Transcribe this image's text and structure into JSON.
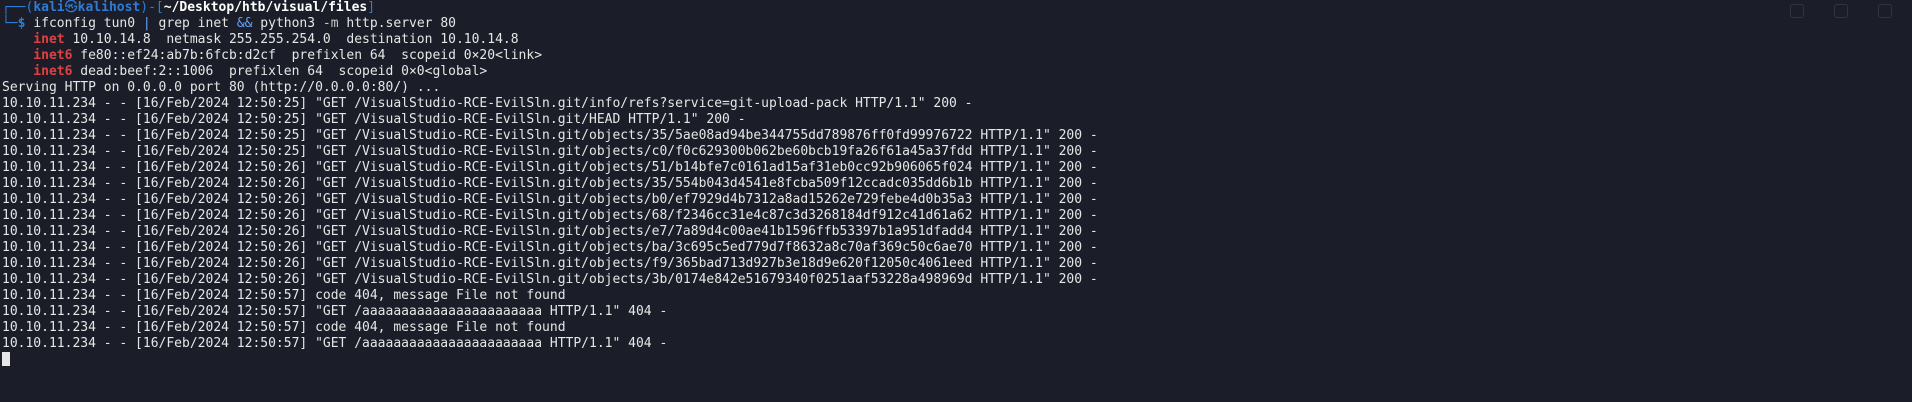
{
  "prompt": {
    "user": "kali",
    "skull": "㉿",
    "host": "kalihost",
    "path": "~/Desktop/htb/visual/files",
    "dollar": "$",
    "command": {
      "w1": "ifconfig tun0 ",
      "pipe": "|",
      "w2": " grep inet ",
      "and": "&&",
      "w3": " python3 ",
      "opt": "-m",
      "w4": " http.server 80"
    }
  },
  "ifconfig": [
    {
      "keyword": "inet",
      "rest": " 10.10.14.8  netmask 255.255.254.0  destination 10.10.14.8"
    },
    {
      "keyword": "inet6",
      "rest": " fe80::ef24:ab7b:6fcb:d2cf  prefixlen 64  scopeid 0×20<link>"
    },
    {
      "keyword": "inet6",
      "rest": " dead:beef:2::1006  prefixlen 64  scopeid 0×0<global>"
    }
  ],
  "serving": "Serving HTTP on 0.0.0.0 port 80 (http://0.0.0.0:80/) ...",
  "log_lines": [
    "10.10.11.234 - - [16/Feb/2024 12:50:25] \"GET /VisualStudio-RCE-EvilSln.git/info/refs?service=git-upload-pack HTTP/1.1\" 200 -",
    "10.10.11.234 - - [16/Feb/2024 12:50:25] \"GET /VisualStudio-RCE-EvilSln.git/HEAD HTTP/1.1\" 200 -",
    "10.10.11.234 - - [16/Feb/2024 12:50:25] \"GET /VisualStudio-RCE-EvilSln.git/objects/35/5ae08ad94be344755dd789876ff0fd99976722 HTTP/1.1\" 200 -",
    "10.10.11.234 - - [16/Feb/2024 12:50:25] \"GET /VisualStudio-RCE-EvilSln.git/objects/c0/f0c629300b062be60bcb19fa26f61a45a37fdd HTTP/1.1\" 200 -",
    "10.10.11.234 - - [16/Feb/2024 12:50:26] \"GET /VisualStudio-RCE-EvilSln.git/objects/51/b14bfe7c0161ad15af31eb0cc92b906065f024 HTTP/1.1\" 200 -",
    "10.10.11.234 - - [16/Feb/2024 12:50:26] \"GET /VisualStudio-RCE-EvilSln.git/objects/35/554b043d4541e8fcba509f12ccadc035dd6b1b HTTP/1.1\" 200 -",
    "10.10.11.234 - - [16/Feb/2024 12:50:26] \"GET /VisualStudio-RCE-EvilSln.git/objects/b0/ef7929d4b7312a8ad15262e729febe4d0b35a3 HTTP/1.1\" 200 -",
    "10.10.11.234 - - [16/Feb/2024 12:50:26] \"GET /VisualStudio-RCE-EvilSln.git/objects/68/f2346cc31e4c87c3d3268184df912c41d61a62 HTTP/1.1\" 200 -",
    "10.10.11.234 - - [16/Feb/2024 12:50:26] \"GET /VisualStudio-RCE-EvilSln.git/objects/e7/7a89d4c00ae41b1596ffb53397b1a951dfadd4 HTTP/1.1\" 200 -",
    "10.10.11.234 - - [16/Feb/2024 12:50:26] \"GET /VisualStudio-RCE-EvilSln.git/objects/ba/3c695c5ed779d7f8632a8c70af369c50c6ae70 HTTP/1.1\" 200 -",
    "10.10.11.234 - - [16/Feb/2024 12:50:26] \"GET /VisualStudio-RCE-EvilSln.git/objects/f9/365bad713d927b3e18d9e620f12050c4061eed HTTP/1.1\" 200 -",
    "10.10.11.234 - - [16/Feb/2024 12:50:26] \"GET /VisualStudio-RCE-EvilSln.git/objects/3b/0174e842e51679340f0251aaf53228a498969d HTTP/1.1\" 200 -",
    "10.10.11.234 - - [16/Feb/2024 12:50:57] code 404, message File not found",
    "10.10.11.234 - - [16/Feb/2024 12:50:57] \"GET /aaaaaaaaaaaaaaaaaaaaaaa HTTP/1.1\" 404 -",
    "10.10.11.234 - - [16/Feb/2024 12:50:57] code 404, message File not found",
    "10.10.11.234 - - [16/Feb/2024 12:50:57] \"GET /aaaaaaaaaaaaaaaaaaaaaaa HTTP/1.1\" 404 -"
  ],
  "colors": {
    "background": "#1b1e28",
    "prompt_blue": "#2f7bd6",
    "inet_red": "#e04040",
    "text": "#e6e6e6"
  }
}
